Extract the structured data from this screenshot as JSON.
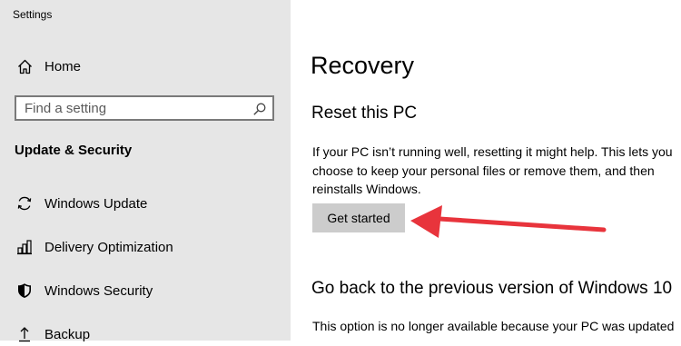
{
  "window": {
    "title": "Settings"
  },
  "sidebar": {
    "home_label": "Home",
    "search": {
      "placeholder": "Find a setting",
      "value": ""
    },
    "section_heading": "Update & Security",
    "items": [
      {
        "label": "Windows Update",
        "icon": "sync-icon"
      },
      {
        "label": "Delivery Optimization",
        "icon": "delivery-optimization-icon"
      },
      {
        "label": "Windows Security",
        "icon": "shield-icon"
      },
      {
        "label": "Backup",
        "icon": "backup-arrow-icon"
      }
    ]
  },
  "main": {
    "title": "Recovery",
    "reset": {
      "heading": "Reset this PC",
      "description_lines": [
        "If your PC isn’t running well, resetting it might help. This lets you",
        "choose to keep your personal files or remove them, and then",
        "reinstalls Windows."
      ],
      "button_label": "Get started"
    },
    "go_back": {
      "heading": "Go back to the previous version of Windows 10",
      "description": "This option is no longer available because your PC was updated"
    }
  },
  "colors": {
    "sidebar_bg": "#e6e6e6",
    "button_bg": "#cccccc",
    "annotation_arrow": "#e8343c"
  }
}
